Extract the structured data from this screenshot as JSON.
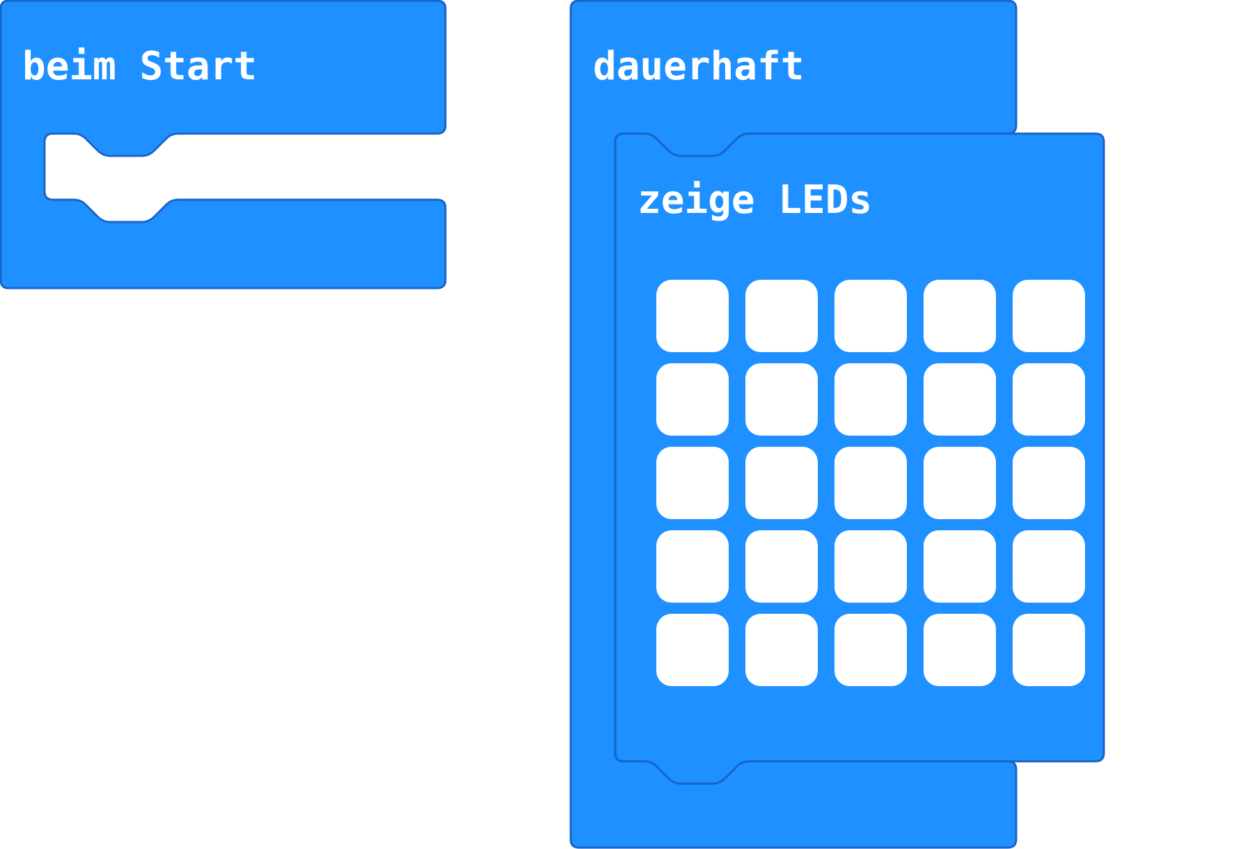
{
  "workspace": {
    "block_fill": "#1e90ff",
    "block_stroke": "#1864c8",
    "background": "#ffffff"
  },
  "blocks": {
    "on_start": {
      "label": "beim Start"
    },
    "forever": {
      "label": "dauerhaft"
    },
    "show_leds": {
      "label": "zeige LEDs",
      "led_color_off": "#ffffff",
      "rows": 5,
      "cols": 5,
      "leds": [
        [
          false,
          false,
          false,
          false,
          false
        ],
        [
          false,
          false,
          false,
          false,
          false
        ],
        [
          false,
          false,
          false,
          false,
          false
        ],
        [
          false,
          false,
          false,
          false,
          false
        ],
        [
          false,
          false,
          false,
          false,
          false
        ]
      ]
    }
  }
}
